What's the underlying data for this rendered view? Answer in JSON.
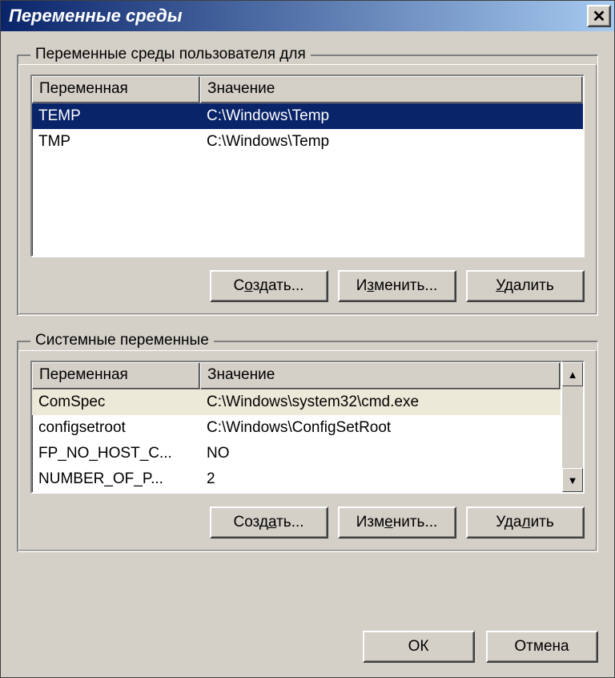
{
  "title": "Переменные среды",
  "close_glyph": "✕",
  "user_group": {
    "legend": "Переменные среды пользователя для",
    "columns": {
      "name": "Переменная",
      "value": "Значение"
    },
    "rows": [
      {
        "name": "TEMP",
        "value": "C:\\Windows\\Temp",
        "selected": true
      },
      {
        "name": "TMP",
        "value": "C:\\Windows\\Temp",
        "selected": false
      }
    ],
    "buttons": {
      "create_pre": "С",
      "create_u": "о",
      "create_post": "здать...",
      "edit_pre": "И",
      "edit_u": "з",
      "edit_post": "менить...",
      "delete_pre": "",
      "delete_u": "У",
      "delete_post": "далить"
    }
  },
  "system_group": {
    "legend": "Системные переменные",
    "columns": {
      "name": "Переменная",
      "value": "Значение"
    },
    "rows": [
      {
        "name": "ComSpec",
        "value": "C:\\Windows\\system32\\cmd.exe"
      },
      {
        "name": "configsetroot",
        "value": "C:\\Windows\\ConfigSetRoot"
      },
      {
        "name": "FP_NO_HOST_C...",
        "value": "NO"
      },
      {
        "name": "NUMBER_OF_P...",
        "value": "2"
      }
    ],
    "buttons": {
      "create_pre": "Созд",
      "create_u": "а",
      "create_post": "ть...",
      "edit_pre": "Изм",
      "edit_u": "е",
      "edit_post": "нить...",
      "delete_pre": "Уда",
      "delete_u": "л",
      "delete_post": "ить"
    },
    "scroll": {
      "up": "▲",
      "down": "▼"
    }
  },
  "dialog_buttons": {
    "ok": "ОК",
    "cancel": "Отмена"
  }
}
